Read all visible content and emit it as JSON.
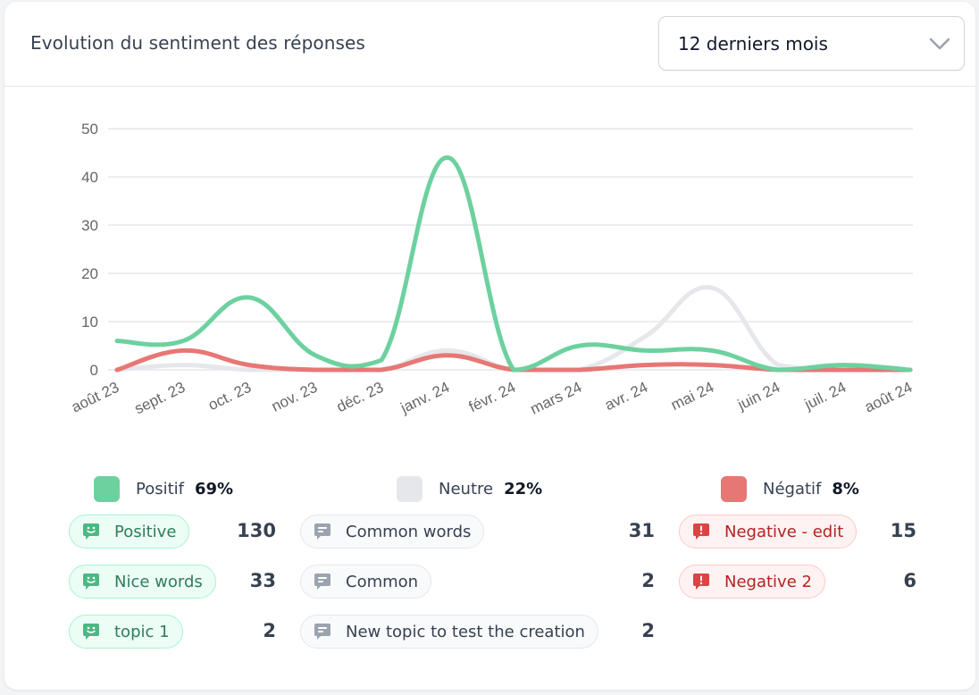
{
  "header": {
    "title": "Evolution du sentiment des réponses",
    "period_select": {
      "value": "12 derniers mois",
      "icon": "chevron-down-icon"
    }
  },
  "colors": {
    "positive": "#6dd19f",
    "neutral": "#e5e7eb",
    "negative": "#e77774",
    "grid": "#e5e7eb",
    "tick_text": "#666666"
  },
  "chart_data": {
    "type": "line",
    "title": "",
    "xlabel": "",
    "ylabel": "",
    "x": [
      "août 23",
      "sept. 23",
      "oct. 23",
      "nov. 23",
      "déc. 23",
      "janv. 24",
      "févr. 24",
      "mars 24",
      "avr. 24",
      "mai 24",
      "juin 24",
      "juil. 24",
      "août 24"
    ],
    "ylim": [
      0,
      50
    ],
    "yticks": [
      0,
      10,
      20,
      30,
      40,
      50
    ],
    "grid": true,
    "smooth": true,
    "series": [
      {
        "name": "Positif",
        "color": "#6dd19f",
        "values": [
          6,
          6,
          15,
          3,
          2,
          44,
          0,
          5,
          4,
          4,
          0,
          1,
          0
        ]
      },
      {
        "name": "Neutre",
        "color": "#e5e7eb",
        "values": [
          0,
          1,
          0,
          0,
          0,
          4,
          0,
          0,
          7,
          17,
          1,
          0,
          0
        ]
      },
      {
        "name": "Négatif",
        "color": "#e77774",
        "values": [
          0,
          4,
          1,
          0,
          0,
          3,
          0,
          0,
          1,
          1,
          0,
          0,
          0
        ]
      }
    ],
    "legend": [
      {
        "label": "Positif",
        "percent": "69%",
        "color": "#6dd19f"
      },
      {
        "label": "Neutre",
        "percent": "22%",
        "color": "#e5e7eb"
      },
      {
        "label": "Négatif",
        "percent": "8%",
        "color": "#e77774"
      }
    ]
  },
  "topics": {
    "positive": [
      {
        "label": "Positive",
        "count": "130",
        "icon": "smile-chat-icon"
      },
      {
        "label": "Nice words",
        "count": "33",
        "icon": "smile-chat-icon"
      },
      {
        "label": "topic 1",
        "count": "2",
        "icon": "smile-chat-icon"
      }
    ],
    "neutral": [
      {
        "label": "Common words",
        "count": "31",
        "icon": "chat-lines-icon"
      },
      {
        "label": "Common",
        "count": "2",
        "icon": "chat-lines-icon"
      },
      {
        "label": "New topic to test the creation",
        "count": "2",
        "icon": "chat-lines-icon"
      }
    ],
    "negative": [
      {
        "label": "Negative - edit",
        "count": "15",
        "icon": "chat-alert-icon"
      },
      {
        "label": "Negative 2",
        "count": "6",
        "icon": "chat-alert-icon"
      }
    ]
  }
}
